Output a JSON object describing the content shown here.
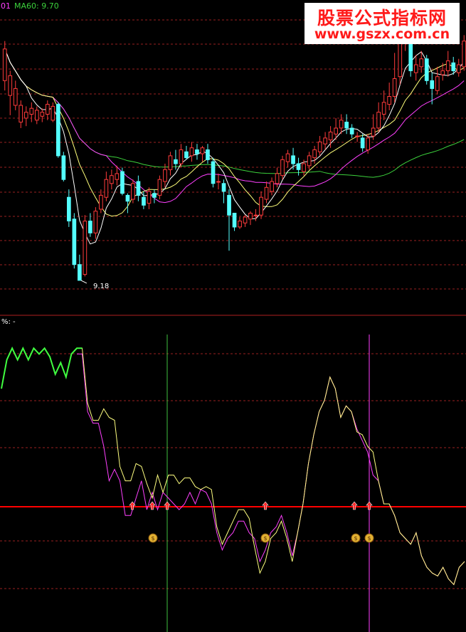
{
  "header": {
    "period": "01",
    "ma_label": "MA60: 9.70"
  },
  "indicator_header": {
    "label": "%: -"
  },
  "watermark": {
    "title": "股票公式指标网",
    "url": "www.gszx.com.cn"
  },
  "colors": {
    "up": "#ff3b3b",
    "down": "#54ffff",
    "ma5": "#ffffff",
    "ma10": "#ffff7a",
    "ma20": "#ff40ff",
    "ma60": "#3cd23c",
    "grid": "#9a1f1f",
    "green_line": "#40ff40",
    "yellow_line": "#ffff80",
    "magenta_line": "#ff40ff",
    "cyan_line": "#54ffff",
    "threshold": "#ff0000",
    "signal": "#ff2a2a"
  },
  "chart_data": [
    {
      "type": "candlestick",
      "title": "",
      "series_labels": [
        "MA60"
      ],
      "ma60_last": 9.7,
      "low_annotation": "9.18",
      "ylim": [
        9.05,
        11.9
      ],
      "candles": [
        [
          11.2,
          11.52,
          11.1,
          11.6
        ],
        [
          11.05,
          11.25,
          10.85,
          11.3
        ],
        [
          10.95,
          11.12,
          10.9,
          11.2
        ],
        [
          10.78,
          10.95,
          10.72,
          11.0
        ],
        [
          10.82,
          10.88,
          10.74,
          10.94
        ],
        [
          10.86,
          10.92,
          10.78,
          10.98
        ],
        [
          10.8,
          10.9,
          10.76,
          10.94
        ],
        [
          10.84,
          10.88,
          10.78,
          10.92
        ],
        [
          10.86,
          10.96,
          10.8,
          11.0
        ],
        [
          10.8,
          10.94,
          10.78,
          10.98
        ],
        [
          10.96,
          10.44,
          10.42,
          10.98
        ],
        [
          10.44,
          10.2,
          10.18,
          10.48
        ],
        [
          10.02,
          9.78,
          9.72,
          10.1
        ],
        [
          9.8,
          9.34,
          9.3,
          9.86
        ],
        [
          9.34,
          9.18,
          9.18,
          9.44
        ],
        [
          9.24,
          9.78,
          9.22,
          9.84
        ],
        [
          9.78,
          9.66,
          9.62,
          9.86
        ],
        [
          9.66,
          9.88,
          9.6,
          9.92
        ],
        [
          9.9,
          10.04,
          9.86,
          10.1
        ],
        [
          10.02,
          10.2,
          9.98,
          10.28
        ],
        [
          10.16,
          10.24,
          10.1,
          10.3
        ],
        [
          10.2,
          10.26,
          10.14,
          10.34
        ],
        [
          10.28,
          10.06,
          10.04,
          10.32
        ],
        [
          10.04,
          9.98,
          9.86,
          10.06
        ],
        [
          10.0,
          10.16,
          9.96,
          10.2
        ],
        [
          10.18,
          10.04,
          9.98,
          10.24
        ],
        [
          10.02,
          9.94,
          9.9,
          10.08
        ],
        [
          9.96,
          10.08,
          9.9,
          10.12
        ],
        [
          10.06,
          10.02,
          9.96,
          10.1
        ],
        [
          10.04,
          10.2,
          10.0,
          10.24
        ],
        [
          10.18,
          10.3,
          10.12,
          10.36
        ],
        [
          10.3,
          10.44,
          10.24,
          10.48
        ],
        [
          10.4,
          10.36,
          10.3,
          10.5
        ],
        [
          10.36,
          10.5,
          10.32,
          10.56
        ],
        [
          10.48,
          10.42,
          10.4,
          10.54
        ],
        [
          10.44,
          10.52,
          10.38,
          10.58
        ],
        [
          10.5,
          10.46,
          10.4,
          10.56
        ],
        [
          10.46,
          10.52,
          10.38,
          10.54
        ],
        [
          10.5,
          10.4,
          10.36,
          10.56
        ],
        [
          10.38,
          10.16,
          10.12,
          10.42
        ],
        [
          10.18,
          10.18,
          10.1,
          10.26
        ],
        [
          10.16,
          10.08,
          9.96,
          10.2
        ],
        [
          10.04,
          9.84,
          9.48,
          10.1
        ],
        [
          9.86,
          9.72,
          9.68,
          9.8
        ],
        [
          9.72,
          9.78,
          9.7,
          9.82
        ],
        [
          9.76,
          9.82,
          9.72,
          9.84
        ],
        [
          9.8,
          9.86,
          9.74,
          9.88
        ],
        [
          9.84,
          9.84,
          9.78,
          9.9
        ],
        [
          9.84,
          10.02,
          9.8,
          10.08
        ],
        [
          10.0,
          10.12,
          9.96,
          10.18
        ],
        [
          10.08,
          10.18,
          10.04,
          10.22
        ],
        [
          10.16,
          10.26,
          10.12,
          10.32
        ],
        [
          10.24,
          10.4,
          10.2,
          10.44
        ],
        [
          10.38,
          10.46,
          10.32,
          10.5
        ],
        [
          10.44,
          10.36,
          10.3,
          10.52
        ],
        [
          10.36,
          10.3,
          10.24,
          10.42
        ],
        [
          10.28,
          10.36,
          10.24,
          10.4
        ],
        [
          10.34,
          10.44,
          10.3,
          10.48
        ],
        [
          10.42,
          10.5,
          10.36,
          10.54
        ],
        [
          10.48,
          10.58,
          10.44,
          10.64
        ],
        [
          10.56,
          10.62,
          10.5,
          10.68
        ],
        [
          10.6,
          10.68,
          10.52,
          10.74
        ],
        [
          10.66,
          10.72,
          10.6,
          10.82
        ],
        [
          10.72,
          10.8,
          10.66,
          10.86
        ],
        [
          10.78,
          10.72,
          10.66,
          10.86
        ],
        [
          10.72,
          10.66,
          10.62,
          10.76
        ],
        [
          10.64,
          10.64,
          10.58,
          10.68
        ],
        [
          10.62,
          10.52,
          10.48,
          10.66
        ],
        [
          10.5,
          10.62,
          10.46,
          10.66
        ],
        [
          10.64,
          10.72,
          10.6,
          10.86
        ],
        [
          10.72,
          10.88,
          10.68,
          10.98
        ],
        [
          10.86,
          10.98,
          10.8,
          11.1
        ],
        [
          10.96,
          11.04,
          10.9,
          11.18
        ],
        [
          11.04,
          11.22,
          10.98,
          11.48
        ],
        [
          11.24,
          11.66,
          11.16,
          11.7
        ],
        [
          11.62,
          11.72,
          11.5,
          11.88
        ],
        [
          11.6,
          11.3,
          11.24,
          11.7
        ],
        [
          11.28,
          11.36,
          11.2,
          11.46
        ],
        [
          11.34,
          11.42,
          11.28,
          11.5
        ],
        [
          11.42,
          11.2,
          11.16,
          11.46
        ],
        [
          11.2,
          11.12,
          10.96,
          11.28
        ],
        [
          11.1,
          11.24,
          11.06,
          11.34
        ],
        [
          11.26,
          11.3,
          11.2,
          11.38
        ],
        [
          11.3,
          11.4,
          11.24,
          11.5
        ],
        [
          11.38,
          11.3,
          11.26,
          11.44
        ],
        [
          11.28,
          11.36,
          11.24,
          11.42
        ],
        [
          11.34,
          11.6,
          11.3,
          11.66
        ]
      ]
    },
    {
      "type": "line",
      "title": "",
      "ylim": [
        0,
        100
      ],
      "threshold": 38,
      "marker_x": [
        46,
        128
      ],
      "series": [
        {
          "values": [
            80,
            90,
            94,
            90,
            94,
            90,
            94,
            92,
            94,
            91,
            85,
            89,
            84,
            92,
            94,
            94,
            75,
            69,
            69,
            73,
            70,
            69,
            53,
            48,
            48,
            54,
            53,
            47,
            42,
            50,
            44,
            50,
            50,
            47,
            49,
            49,
            46,
            45,
            46,
            45,
            32,
            26,
            30,
            34,
            38,
            38,
            35,
            25,
            16,
            20,
            28,
            30,
            34,
            28,
            20,
            30,
            40,
            54,
            64,
            72,
            76,
            84,
            80,
            70,
            74,
            72,
            65,
            64,
            60,
            58,
            48,
            40,
            40,
            36,
            30,
            28,
            26,
            30,
            22,
            18,
            16,
            15,
            18,
            14,
            12,
            18,
            20
          ]
        },
        {
          "values": [
            null,
            null,
            null,
            null,
            null,
            null,
            null,
            null,
            null,
            null,
            null,
            null,
            null,
            null,
            92,
            92,
            72,
            68,
            68,
            60,
            48,
            52,
            48,
            36,
            36,
            42,
            48,
            38,
            44,
            38,
            44,
            42,
            40,
            38,
            40,
            44,
            40,
            45,
            44,
            40,
            30,
            24,
            28,
            30,
            34,
            34,
            30,
            28,
            20,
            24,
            30,
            32,
            36,
            30,
            22,
            30,
            40,
            54,
            64,
            72,
            76,
            84,
            80,
            70,
            74,
            72,
            66,
            62,
            58,
            50,
            48,
            40,
            40,
            36,
            30,
            28,
            26,
            30,
            22,
            18,
            16,
            15,
            18,
            14,
            12,
            18,
            20
          ]
        },
        {
          "values": [
            null,
            null,
            null,
            null,
            null,
            null,
            null,
            null,
            null,
            null,
            null,
            null,
            null,
            null,
            null,
            null,
            null,
            null,
            null,
            null,
            null,
            null,
            null,
            null,
            null,
            null,
            null,
            null,
            null,
            null,
            null,
            null,
            null,
            null,
            null,
            null,
            null,
            null,
            null,
            null,
            null,
            null,
            null,
            null,
            null,
            null,
            null,
            null,
            null,
            null,
            null,
            null,
            null,
            null,
            null,
            null,
            null,
            null,
            null,
            null,
            null,
            null,
            null,
            null,
            null,
            null,
            null,
            null,
            null,
            null,
            null,
            null,
            null,
            null,
            null,
            null,
            null,
            null,
            null,
            null,
            null,
            null,
            null,
            null,
            null,
            null,
            null
          ]
        }
      ]
    }
  ]
}
